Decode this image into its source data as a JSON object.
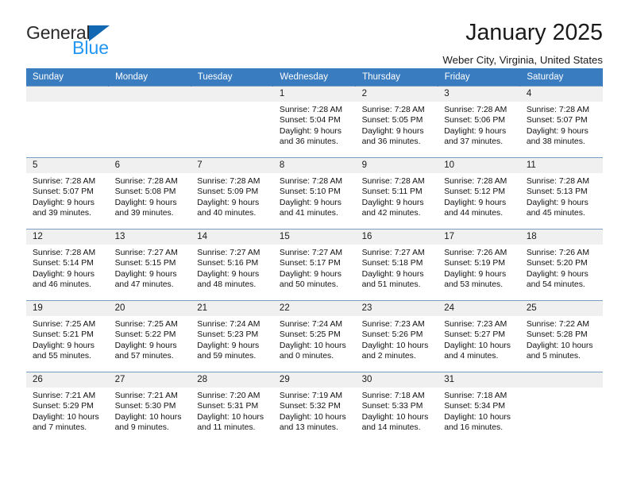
{
  "logo": {
    "word_primary": "General",
    "word_secondary": "Blue",
    "triangle_color": "#1268b3",
    "secondary_color": "#2196f3"
  },
  "header": {
    "title": "January 2025",
    "location": "Weber City, Virginia, United States"
  },
  "theme": {
    "header_bar": "#3a7cc0",
    "daynum_band": "#f0f0f0",
    "row_divider": "#7a9cc0"
  },
  "weekday_headers": [
    "Sunday",
    "Monday",
    "Tuesday",
    "Wednesday",
    "Thursday",
    "Friday",
    "Saturday"
  ],
  "weeks": [
    [
      {
        "day": "",
        "lines": []
      },
      {
        "day": "",
        "lines": []
      },
      {
        "day": "",
        "lines": []
      },
      {
        "day": "1",
        "lines": [
          "Sunrise: 7:28 AM",
          "Sunset: 5:04 PM",
          "Daylight: 9 hours",
          "and 36 minutes."
        ]
      },
      {
        "day": "2",
        "lines": [
          "Sunrise: 7:28 AM",
          "Sunset: 5:05 PM",
          "Daylight: 9 hours",
          "and 36 minutes."
        ]
      },
      {
        "day": "3",
        "lines": [
          "Sunrise: 7:28 AM",
          "Sunset: 5:06 PM",
          "Daylight: 9 hours",
          "and 37 minutes."
        ]
      },
      {
        "day": "4",
        "lines": [
          "Sunrise: 7:28 AM",
          "Sunset: 5:07 PM",
          "Daylight: 9 hours",
          "and 38 minutes."
        ]
      }
    ],
    [
      {
        "day": "5",
        "lines": [
          "Sunrise: 7:28 AM",
          "Sunset: 5:07 PM",
          "Daylight: 9 hours",
          "and 39 minutes."
        ]
      },
      {
        "day": "6",
        "lines": [
          "Sunrise: 7:28 AM",
          "Sunset: 5:08 PM",
          "Daylight: 9 hours",
          "and 39 minutes."
        ]
      },
      {
        "day": "7",
        "lines": [
          "Sunrise: 7:28 AM",
          "Sunset: 5:09 PM",
          "Daylight: 9 hours",
          "and 40 minutes."
        ]
      },
      {
        "day": "8",
        "lines": [
          "Sunrise: 7:28 AM",
          "Sunset: 5:10 PM",
          "Daylight: 9 hours",
          "and 41 minutes."
        ]
      },
      {
        "day": "9",
        "lines": [
          "Sunrise: 7:28 AM",
          "Sunset: 5:11 PM",
          "Daylight: 9 hours",
          "and 42 minutes."
        ]
      },
      {
        "day": "10",
        "lines": [
          "Sunrise: 7:28 AM",
          "Sunset: 5:12 PM",
          "Daylight: 9 hours",
          "and 44 minutes."
        ]
      },
      {
        "day": "11",
        "lines": [
          "Sunrise: 7:28 AM",
          "Sunset: 5:13 PM",
          "Daylight: 9 hours",
          "and 45 minutes."
        ]
      }
    ],
    [
      {
        "day": "12",
        "lines": [
          "Sunrise: 7:28 AM",
          "Sunset: 5:14 PM",
          "Daylight: 9 hours",
          "and 46 minutes."
        ]
      },
      {
        "day": "13",
        "lines": [
          "Sunrise: 7:27 AM",
          "Sunset: 5:15 PM",
          "Daylight: 9 hours",
          "and 47 minutes."
        ]
      },
      {
        "day": "14",
        "lines": [
          "Sunrise: 7:27 AM",
          "Sunset: 5:16 PM",
          "Daylight: 9 hours",
          "and 48 minutes."
        ]
      },
      {
        "day": "15",
        "lines": [
          "Sunrise: 7:27 AM",
          "Sunset: 5:17 PM",
          "Daylight: 9 hours",
          "and 50 minutes."
        ]
      },
      {
        "day": "16",
        "lines": [
          "Sunrise: 7:27 AM",
          "Sunset: 5:18 PM",
          "Daylight: 9 hours",
          "and 51 minutes."
        ]
      },
      {
        "day": "17",
        "lines": [
          "Sunrise: 7:26 AM",
          "Sunset: 5:19 PM",
          "Daylight: 9 hours",
          "and 53 minutes."
        ]
      },
      {
        "day": "18",
        "lines": [
          "Sunrise: 7:26 AM",
          "Sunset: 5:20 PM",
          "Daylight: 9 hours",
          "and 54 minutes."
        ]
      }
    ],
    [
      {
        "day": "19",
        "lines": [
          "Sunrise: 7:25 AM",
          "Sunset: 5:21 PM",
          "Daylight: 9 hours",
          "and 55 minutes."
        ]
      },
      {
        "day": "20",
        "lines": [
          "Sunrise: 7:25 AM",
          "Sunset: 5:22 PM",
          "Daylight: 9 hours",
          "and 57 minutes."
        ]
      },
      {
        "day": "21",
        "lines": [
          "Sunrise: 7:24 AM",
          "Sunset: 5:23 PM",
          "Daylight: 9 hours",
          "and 59 minutes."
        ]
      },
      {
        "day": "22",
        "lines": [
          "Sunrise: 7:24 AM",
          "Sunset: 5:25 PM",
          "Daylight: 10 hours",
          "and 0 minutes."
        ]
      },
      {
        "day": "23",
        "lines": [
          "Sunrise: 7:23 AM",
          "Sunset: 5:26 PM",
          "Daylight: 10 hours",
          "and 2 minutes."
        ]
      },
      {
        "day": "24",
        "lines": [
          "Sunrise: 7:23 AM",
          "Sunset: 5:27 PM",
          "Daylight: 10 hours",
          "and 4 minutes."
        ]
      },
      {
        "day": "25",
        "lines": [
          "Sunrise: 7:22 AM",
          "Sunset: 5:28 PM",
          "Daylight: 10 hours",
          "and 5 minutes."
        ]
      }
    ],
    [
      {
        "day": "26",
        "lines": [
          "Sunrise: 7:21 AM",
          "Sunset: 5:29 PM",
          "Daylight: 10 hours",
          "and 7 minutes."
        ]
      },
      {
        "day": "27",
        "lines": [
          "Sunrise: 7:21 AM",
          "Sunset: 5:30 PM",
          "Daylight: 10 hours",
          "and 9 minutes."
        ]
      },
      {
        "day": "28",
        "lines": [
          "Sunrise: 7:20 AM",
          "Sunset: 5:31 PM",
          "Daylight: 10 hours",
          "and 11 minutes."
        ]
      },
      {
        "day": "29",
        "lines": [
          "Sunrise: 7:19 AM",
          "Sunset: 5:32 PM",
          "Daylight: 10 hours",
          "and 13 minutes."
        ]
      },
      {
        "day": "30",
        "lines": [
          "Sunrise: 7:18 AM",
          "Sunset: 5:33 PM",
          "Daylight: 10 hours",
          "and 14 minutes."
        ]
      },
      {
        "day": "31",
        "lines": [
          "Sunrise: 7:18 AM",
          "Sunset: 5:34 PM",
          "Daylight: 10 hours",
          "and 16 minutes."
        ]
      },
      {
        "day": "",
        "lines": []
      }
    ]
  ]
}
